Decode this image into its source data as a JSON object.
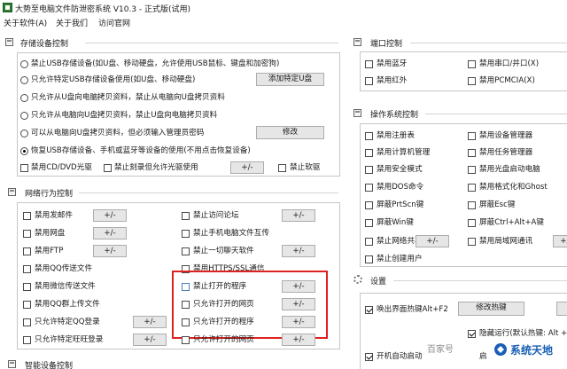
{
  "title": "大势至电脑文件防泄密系统 V10.3 - 正式版(试用)",
  "menu": [
    "关于软件(A)",
    "关于我们",
    "访问官网"
  ],
  "storage": {
    "title": "存储设备控制",
    "radios": [
      "禁止USB存储设备(如U盘、移动硬盘，允许使用USB鼠标、键盘和加密狗)",
      "只允许特定USB存储设备使用(如U盘、移动硬盘)",
      "只允许从U盘向电脑拷贝资料，禁止从电脑向U盘拷贝资料",
      "只允许从电脑向U盘拷贝资料，禁止U盘向电脑拷贝资料",
      "可以从电脑向U盘拷贝资料，但必须输入管理员密码",
      "恢复USB存储设备、手机或蓝牙等设备的使用(不用点击恢复设备)"
    ],
    "add_usb_button": "添加特定U盘",
    "modify_button": "修改",
    "cd_checkboxes": [
      "禁用CD/DVD光驱",
      "禁止刻录但允许光驱使用",
      "禁止软驱"
    ],
    "cd_pm": "+/-"
  },
  "network": {
    "title": "网络行为控制",
    "left": [
      "禁用发邮件",
      "禁用网盘",
      "禁用FTP",
      "禁用QQ传送文件",
      "禁用微信传送文件",
      "禁用QQ群上传文件",
      "只允许特定QQ登录",
      "只允许特定旺旺登录"
    ],
    "right": [
      "禁止访问论坛",
      "禁止手机电脑文件互传",
      "禁止一切聊天软件",
      "禁用HTTPS/SSL通信",
      "禁止打开的程序",
      "只允许打开的网页",
      "只允许打开的程序",
      "只允许打开的网页"
    ],
    "pm": "+/-"
  },
  "port": {
    "title": "端口控制",
    "items": [
      "禁用蓝牙",
      "禁用串口/并口(X)",
      "禁用红外",
      "禁用PCMCIA(X)"
    ]
  },
  "os": {
    "title": "操作系统控制",
    "left": [
      "禁用注册表",
      "禁用计算机管理",
      "禁用安全模式",
      "禁用DOS命令",
      "屏蔽PrtScn键",
      "屏蔽Win键",
      "禁止网络共享",
      "禁止创建用户"
    ],
    "right": [
      "禁用设备管理器",
      "禁用任务管理器",
      "禁用光盘启动电脑",
      "禁用格式化和Ghost",
      "屏蔽Esc键",
      "屏蔽Ctrl+Alt+A键",
      "禁用局域网通讯"
    ],
    "pm": "+/-"
  },
  "settings": {
    "title": "设置",
    "hotkey_label": "唤出界面热键Alt+F2",
    "modify_hotkey": "修改热键",
    "hidden_run": "隐藏运行(默认热键: Alt +",
    "autostart": "开机自动启动",
    "bottom_cut": "启"
  },
  "smart": {
    "title": "智能设备控制"
  },
  "watermark": {
    "left": "百家号",
    "right": "系统天地"
  }
}
